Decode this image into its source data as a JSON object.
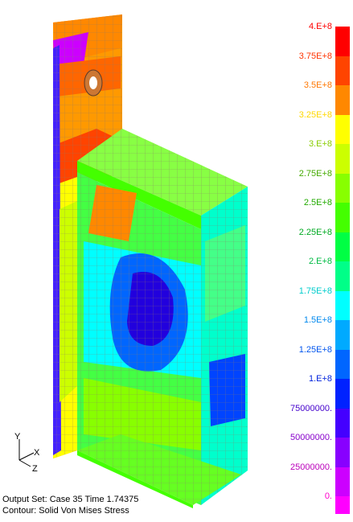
{
  "legend": {
    "bands": [
      {
        "label": "4.E+8",
        "color": "#ff0000",
        "label_color": "#ff0000"
      },
      {
        "label": "3.75E+8",
        "color": "#ff4400",
        "label_color": "#ff3300"
      },
      {
        "label": "3.5E+8",
        "color": "#ff8800",
        "label_color": "#ff7700"
      },
      {
        "label": "3.25E+8",
        "color": "#ffff00",
        "label_color": "#ffd800"
      },
      {
        "label": "3.E+8",
        "color": "#ccff00",
        "label_color": "#88cc00"
      },
      {
        "label": "2.75E+8",
        "color": "#88ff00",
        "label_color": "#44aa00"
      },
      {
        "label": "2.5E+8",
        "color": "#44ff00",
        "label_color": "#22aa00"
      },
      {
        "label": "2.25E+8",
        "color": "#00ff44",
        "label_color": "#00aa22"
      },
      {
        "label": "2.E+8",
        "color": "#00ff88",
        "label_color": "#00bb44"
      },
      {
        "label": "1.75E+8",
        "color": "#00ffff",
        "label_color": "#00cccc"
      },
      {
        "label": "1.5E+8",
        "color": "#00aaff",
        "label_color": "#0088ee"
      },
      {
        "label": "1.25E+8",
        "color": "#0066ff",
        "label_color": "#0055ee"
      },
      {
        "label": "1.E+8",
        "color": "#0022ff",
        "label_color": "#0022dd"
      },
      {
        "label": "75000000.",
        "color": "#4400ff",
        "label_color": "#4400cc"
      },
      {
        "label": "50000000.",
        "color": "#8800ff",
        "label_color": "#8800cc"
      },
      {
        "label": "25000000.",
        "color": "#cc00ff",
        "label_color": "#bb00bb"
      },
      {
        "label": "0.",
        "color": "#ff00ff",
        "label_color": "#ff00cc"
      }
    ]
  },
  "axes": {
    "y": "Y",
    "x": "X",
    "z": "Z"
  },
  "info": {
    "output_set": "Output Set: Case 35 Time 1.74375",
    "contour": "Contour: Solid Von Mises Stress"
  }
}
